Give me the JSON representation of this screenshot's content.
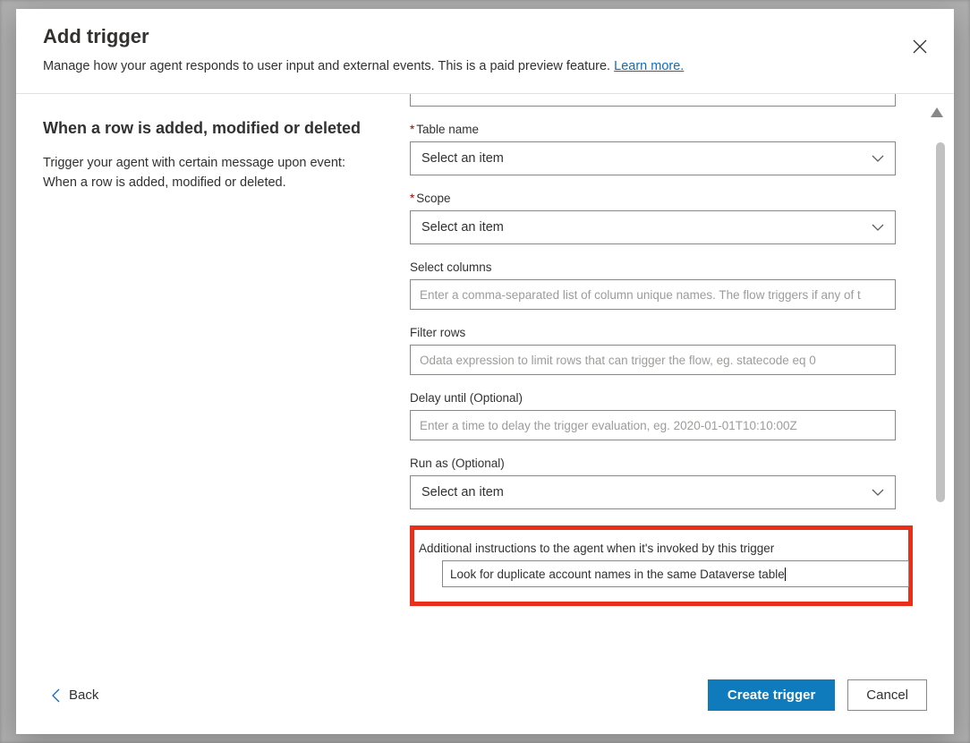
{
  "dialog": {
    "title": "Add trigger",
    "subtitle": "Manage how your agent responds to user input and external events. This is a paid preview feature. ",
    "learn_more": "Learn more."
  },
  "left": {
    "trigger_name": "When a row is added, modified or deleted",
    "trigger_desc": "Trigger your agent with certain message upon event: When a row is added, modified or deleted."
  },
  "form": {
    "table_name": {
      "label": "Table name",
      "value": "Select an item"
    },
    "scope": {
      "label": "Scope",
      "value": "Select an item"
    },
    "select_columns": {
      "label": "Select columns",
      "placeholder": "Enter a comma-separated list of column unique names. The flow triggers if any of t"
    },
    "filter_rows": {
      "label": "Filter rows",
      "placeholder": "Odata expression to limit rows that can trigger the flow, eg. statecode eq 0"
    },
    "delay_until": {
      "label": "Delay until (Optional)",
      "placeholder": "Enter a time to delay the trigger evaluation, eg. 2020-01-01T10:10:00Z"
    },
    "run_as": {
      "label": "Run as (Optional)",
      "value": "Select an item"
    },
    "instructions": {
      "label": "Additional instructions to the agent when it's invoked by this trigger",
      "value": "Look for duplicate account names in the same Dataverse table"
    }
  },
  "footer": {
    "back": "Back",
    "create": "Create trigger",
    "cancel": "Cancel"
  }
}
